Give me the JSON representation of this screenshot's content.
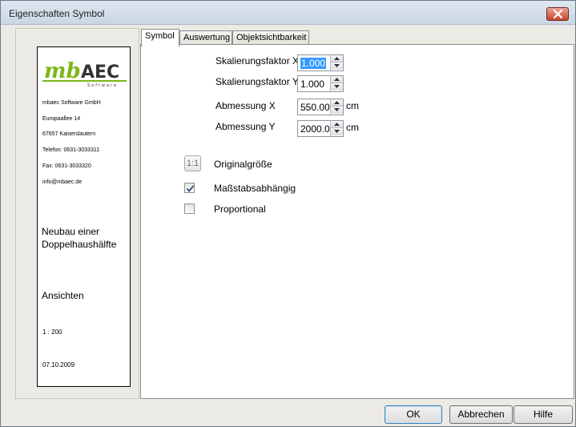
{
  "window": {
    "title": "Eigenschaften Symbol"
  },
  "preview": {
    "logo": {
      "main": "mbAEC",
      "sub": "Software"
    },
    "address": [
      "mbaec Software GmbH",
      "Europaallee 14",
      "67657 Kaiserslautern",
      "Telefon: 0631-3033311",
      "Fax: 0631-3033320",
      "info@mbaec.de"
    ],
    "project_line1": "Neubau einer",
    "project_line2": "Doppelhaushälfte",
    "view": "Ansichten",
    "scale": "1 : 200",
    "date": "07.10.2009"
  },
  "tabs": [
    {
      "label": "Symbol",
      "active": true
    },
    {
      "label": "Auswertung",
      "active": false
    },
    {
      "label": "Objektsichtbarkeit",
      "active": false
    }
  ],
  "fields": {
    "scale_x": {
      "label": "Skalierungsfaktor X",
      "value": "1.000"
    },
    "scale_y": {
      "label": "Skalierungsfaktor Y",
      "value": "1.000"
    },
    "dim_x": {
      "label": "Abmessung X",
      "value": "550.000",
      "unit": "cm"
    },
    "dim_y": {
      "label": "Abmessung Y",
      "value": "2000.00",
      "unit": "cm"
    }
  },
  "original_size": {
    "icon_text": "1:1",
    "label": "Originalgröße"
  },
  "checkboxes": {
    "scale_dependent": {
      "label": "Maßstabsabhängig",
      "checked": true
    },
    "proportional": {
      "label": "Proportional",
      "checked": false
    }
  },
  "buttons": {
    "ok": "OK",
    "cancel": "Abbrechen",
    "help": "Hilfe"
  },
  "colors": {
    "logo_green": "#7cb518",
    "logo_dark": "#333333",
    "selection": "#3399ff"
  }
}
